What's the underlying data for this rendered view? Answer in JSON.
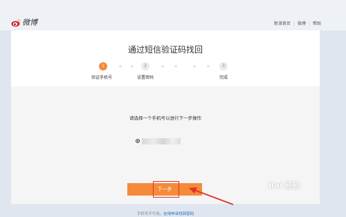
{
  "header": {
    "logo_text": "微博",
    "nav": [
      "新浪首页",
      "微博",
      "帮助"
    ]
  },
  "main": {
    "title": "通过短信验证码找回",
    "steps": [
      {
        "number": "1",
        "label": "验证手机号",
        "active": true
      },
      {
        "number": "2",
        "label": "设置密码",
        "active": false
      },
      {
        "number": "3",
        "label": "完成",
        "active": false
      }
    ],
    "prompt": "请选择一个手机号以进行下一步操作",
    "next_button": "下一步",
    "footnote_text": "手机号不可用。",
    "footnote_link": "在线申诉找回密码"
  },
  "watermark": "Bai 经验",
  "colors": {
    "accent": "#f58a3a",
    "highlight": "#e0302a",
    "link": "#1f6fb5"
  }
}
